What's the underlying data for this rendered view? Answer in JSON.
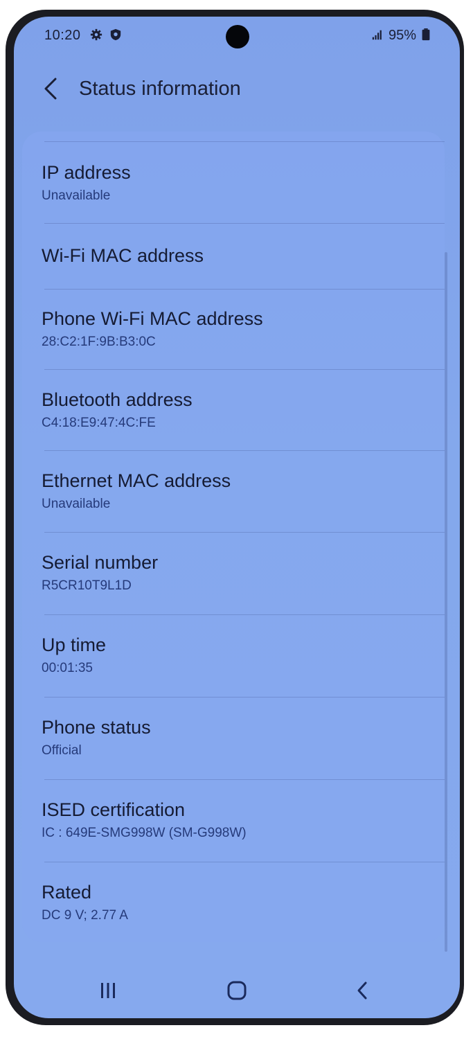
{
  "status_bar": {
    "time": "10:20",
    "battery": "95%",
    "icons": [
      "gear-icon",
      "shield-icon",
      "signal-icon",
      "battery-icon"
    ]
  },
  "header": {
    "title": "Status information"
  },
  "items": [
    {
      "label": "IP address",
      "value": "Unavailable"
    },
    {
      "label": "Wi-Fi MAC address",
      "value": ""
    },
    {
      "label": "Phone Wi-Fi MAC address",
      "value": "28:C2:1F:9B:B3:0C"
    },
    {
      "label": "Bluetooth address",
      "value": "C4:18:E9:47:4C:FE"
    },
    {
      "label": "Ethernet MAC address",
      "value": "Unavailable"
    },
    {
      "label": "Serial number",
      "value": "R5CR10T9L1D"
    },
    {
      "label": "Up time",
      "value": "00:01:35"
    },
    {
      "label": "Phone status",
      "value": "Official"
    },
    {
      "label": "ISED certification",
      "value": "IC : 649E-SMG998W (SM-G998W)"
    },
    {
      "label": "Rated",
      "value": "DC 9 V; 2.77 A"
    }
  ],
  "colors": {
    "screen_background": "#84a8ec",
    "text_primary": "#151b33",
    "text_secondary": "#253a7a"
  }
}
